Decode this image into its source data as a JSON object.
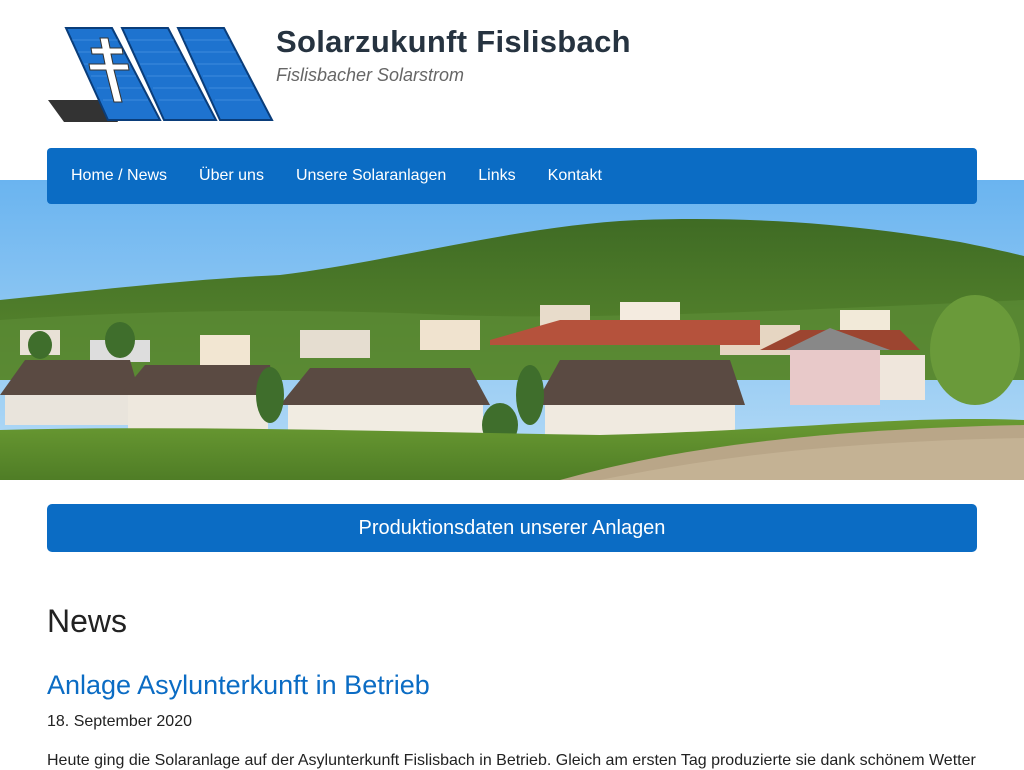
{
  "header": {
    "title": "Solarzukunft Fislisbach",
    "tagline": "Fislisbacher Solarstrom"
  },
  "nav": {
    "items": [
      {
        "label": "Home / News"
      },
      {
        "label": "Über uns"
      },
      {
        "label": "Unsere Solaranlagen"
      },
      {
        "label": "Links"
      },
      {
        "label": "Kontakt"
      }
    ]
  },
  "production_button": {
    "label": "Produktionsdaten unserer Anlagen"
  },
  "content": {
    "section_title": "News",
    "post": {
      "title": "Anlage Asylunterkunft in Betrieb",
      "date": "18. September 2020",
      "body": "Heute ging die Solaranlage auf der Asylunterkunft Fislisbach in Betrieb. Gleich am ersten Tag produzierte sie dank schönem Wetter"
    }
  },
  "colors": {
    "accent": "#0b6cc4",
    "title": "#263340"
  }
}
